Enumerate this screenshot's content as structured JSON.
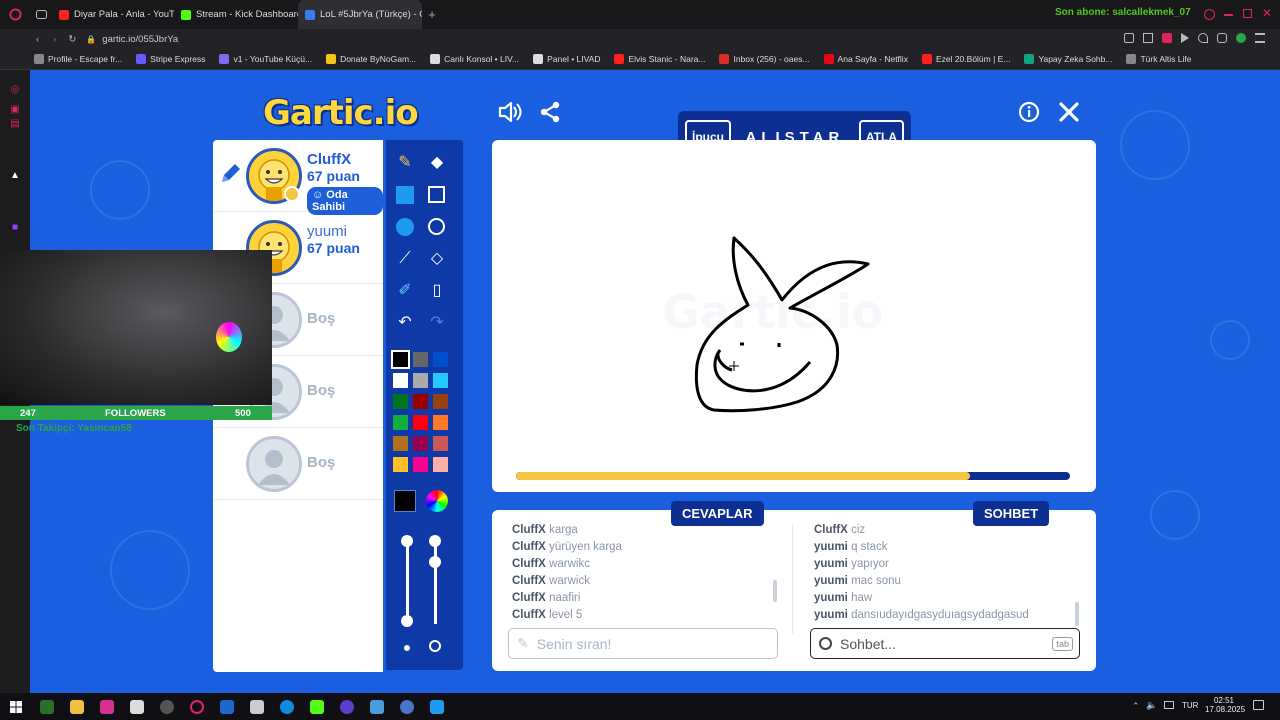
{
  "browser": {
    "tabs": [
      {
        "title": "Diyar Pala - Anla - YouTube",
        "color": "#ff2020"
      },
      {
        "title": "Stream - Kick Dashboard",
        "color": "#53fc18"
      },
      {
        "title": "LoL #5JbrYa (Türkçe) - G",
        "color": "#3a7cf0"
      }
    ],
    "subscriber_text": "Son abone: salcallekmek_07",
    "url": "gartic.io/055JbrYa",
    "bookmarks": [
      "Profile - Escape fr...",
      "Stripe Express",
      "v1 - YouTube Küçü...",
      "Donate ByNoGam...",
      "Canlı Konsol • LIV...",
      "Panel • LIVAD",
      "Elvis Stanic - Nara...",
      "Inbox (256) - oaes...",
      "Ana Sayfa - Netflix",
      "Ezel 20.Bölüm | E...",
      "Yapay Zeka Sohb...",
      "Türk Altis Life"
    ]
  },
  "game": {
    "logo_text": "Gartic.io",
    "hint_label": "İpucu",
    "word": "ALISTAR",
    "skip_label": "ATLA",
    "timer_fraction": 0.82,
    "players": [
      {
        "name": "CluffX",
        "points": "67 puan",
        "owner_badge": "Oda Sahibi",
        "drawing": true
      },
      {
        "name": "yuumi",
        "points": "67 puan"
      },
      {
        "name": "Boş"
      },
      {
        "name": "Boş"
      },
      {
        "name": "Boş"
      }
    ],
    "palette": [
      "#000000",
      "#666666",
      "#0050cd",
      "#ffffff",
      "#aaaaaa",
      "#26c9ff",
      "#017420",
      "#990000",
      "#964112",
      "#11b03c",
      "#ff0013",
      "#ff7829",
      "#b0701c",
      "#99004e",
      "#cb5a57",
      "#ffc126",
      "#ff008f",
      "#feafa8"
    ],
    "current_color": "#000000",
    "answers_label": "CEVAPLAR",
    "chat_label": "SOHBET",
    "answers": [
      {
        "user": "CluffX",
        "text": "karga"
      },
      {
        "user": "CluffX",
        "text": "yürüyen karga"
      },
      {
        "user": "CluffX",
        "text": "warwikc"
      },
      {
        "user": "CluffX",
        "text": "warwick"
      },
      {
        "user": "CluffX",
        "text": "naafiri"
      },
      {
        "user": "CluffX",
        "text": "level 5"
      }
    ],
    "chat": [
      {
        "user": "CluffX",
        "text": "ciz"
      },
      {
        "user": "yuumi",
        "text": "q stack"
      },
      {
        "user": "yuumi",
        "text": "yapıyor"
      },
      {
        "user": "yuumi",
        "text": "mac sonu"
      },
      {
        "user": "yuumi",
        "text": "haw"
      },
      {
        "user": "yuumi",
        "text": "dansıudayıdgasyduıagsydadgasud"
      }
    ],
    "answer_placeholder": "Senin sıran!",
    "chat_placeholder": "Sohbet...",
    "tab_hint": "tab"
  },
  "overlay": {
    "followers_count": "247",
    "followers_label": "FOLLOWERS",
    "followers_goal": "500",
    "last_follower": "Son Takipçi: Yasincan58"
  },
  "taskbar": {
    "lang": "TUR",
    "time": "02:51",
    "date": "17.08.2025"
  }
}
